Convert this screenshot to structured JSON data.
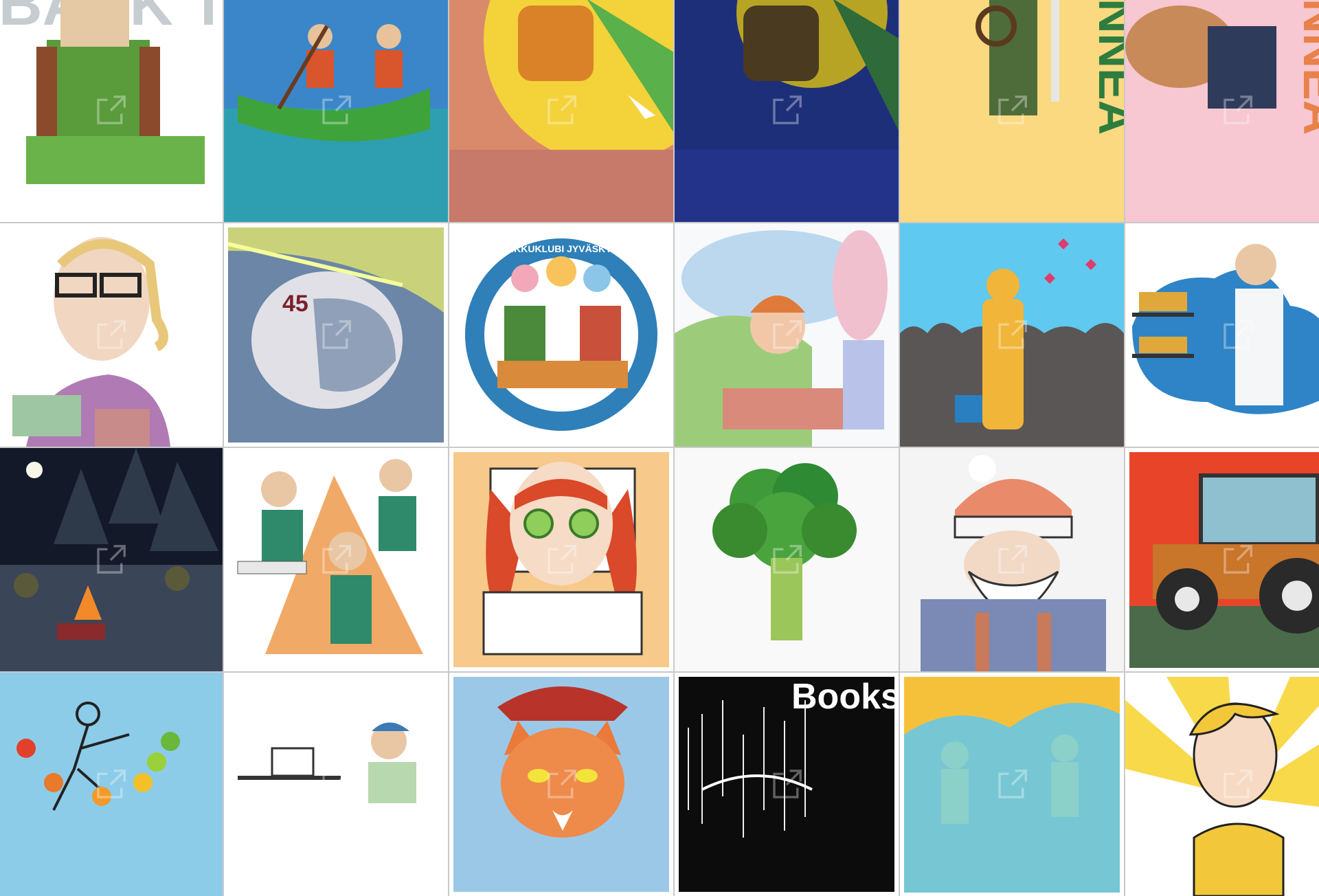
{
  "gallery": {
    "tiles": [
      {
        "row": 0,
        "col": 0,
        "subject": "student-backpack",
        "text": "BACK TO SCHOOL"
      },
      {
        "row": 0,
        "col": 1,
        "subject": "boat-rowers"
      },
      {
        "row": 0,
        "col": 2,
        "subject": "balloon-day"
      },
      {
        "row": 0,
        "col": 3,
        "subject": "balloon-night"
      },
      {
        "row": 0,
        "col": 4,
        "subject": "soldier-keyboard",
        "text": "NNEA"
      },
      {
        "row": 0,
        "col": 5,
        "subject": "woman-dog",
        "text": "NNEA"
      },
      {
        "row": 1,
        "col": 0,
        "subject": "glasses-student"
      },
      {
        "row": 1,
        "col": 1,
        "subject": "helmet-45",
        "text": "45"
      },
      {
        "row": 1,
        "col": 2,
        "subject": "sinkkuklubi-badge",
        "text": "SINKKUKLUBI JYVÄSKYLÄ"
      },
      {
        "row": 1,
        "col": 3,
        "subject": "girl-wall"
      },
      {
        "row": 1,
        "col": 4,
        "subject": "robot-hearts"
      },
      {
        "row": 1,
        "col": 5,
        "subject": "pharmacist"
      },
      {
        "row": 2,
        "col": 0,
        "subject": "campfire-night"
      },
      {
        "row": 2,
        "col": 1,
        "subject": "nurses"
      },
      {
        "row": 2,
        "col": 2,
        "subject": "cucumber-face"
      },
      {
        "row": 2,
        "col": 3,
        "subject": "broccoli"
      },
      {
        "row": 2,
        "col": 4,
        "subject": "santa-beard"
      },
      {
        "row": 2,
        "col": 5,
        "subject": "tractor"
      },
      {
        "row": 3,
        "col": 0,
        "subject": "dancer-dots"
      },
      {
        "row": 3,
        "col": 1,
        "subject": "man-laptop"
      },
      {
        "row": 3,
        "col": 2,
        "subject": "cat-beret"
      },
      {
        "row": 3,
        "col": 3,
        "subject": "books-black",
        "text": "Books"
      },
      {
        "row": 3,
        "col": 4,
        "subject": "mermaids"
      },
      {
        "row": 3,
        "col": 5,
        "subject": "sun-boy"
      }
    ],
    "icon": "external-link-icon",
    "colors": {
      "grid_gap": "#c9c9c9",
      "tile_bg": "#ffffff"
    }
  }
}
